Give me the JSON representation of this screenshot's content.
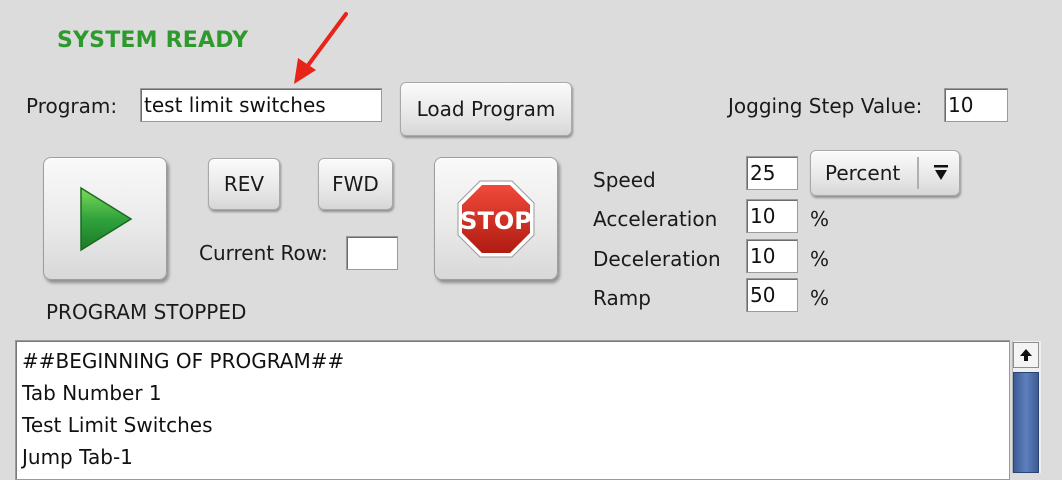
{
  "status": {
    "text": "SYSTEM READY",
    "color": "#2e9a2e"
  },
  "annotation": {
    "icon": "red-arrow-icon",
    "color": "#e8231a"
  },
  "program": {
    "label": "Program:",
    "value": "test limit switches"
  },
  "load_button": {
    "label": "Load Program"
  },
  "jogging": {
    "label": "Jogging Step Value:",
    "value": "10"
  },
  "controls": {
    "play_icon": "play-icon",
    "rev_label": "REV",
    "fwd_label": "FWD",
    "stop_icon_text": "STOP",
    "current_row_label": "Current Row:",
    "current_row_value": ""
  },
  "program_state": "PROGRAM STOPPED",
  "params": {
    "speed": {
      "label": "Speed",
      "value": "25",
      "unit_select": "Percent"
    },
    "acceleration": {
      "label": "Acceleration",
      "value": "10",
      "unit": "%"
    },
    "deceleration": {
      "label": "Deceleration",
      "value": "10",
      "unit": "%"
    },
    "ramp": {
      "label": "Ramp",
      "value": "50",
      "unit": "%"
    }
  },
  "program_listing": {
    "lines": [
      "##BEGINNING OF PROGRAM##",
      "Tab Number 1",
      "Test Limit Switches",
      "Jump Tab-1"
    ]
  }
}
